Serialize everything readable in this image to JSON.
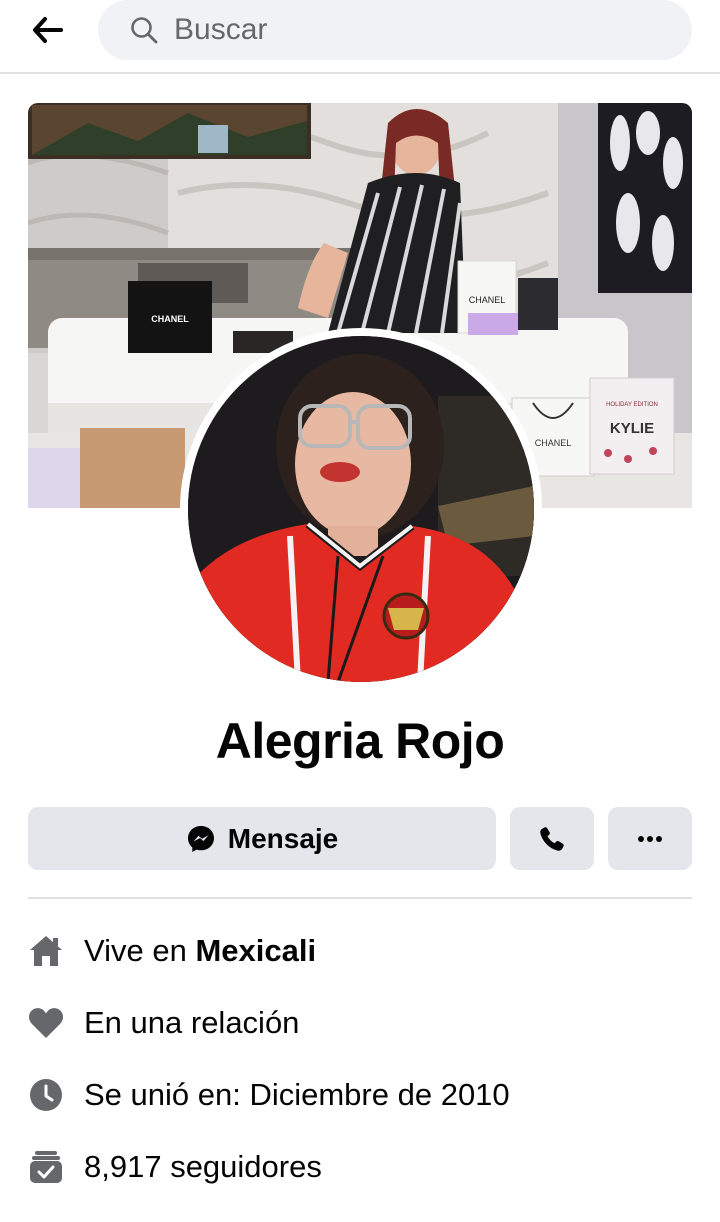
{
  "header": {
    "search_placeholder": "Buscar"
  },
  "cover": {
    "brand_left": "CHANEL",
    "brand_right": "CHANEL",
    "brand_bag": "CHANEL",
    "brand_kylie": "KYLIE",
    "brand_kylie_sub": "HOLIDAY EDITION"
  },
  "profile": {
    "name": "Alegria Rojo"
  },
  "actions": {
    "message_label": "Mensaje"
  },
  "info": {
    "lives_prefix": "Vive en ",
    "lives_city": "Mexicali",
    "relationship": "En una relación",
    "joined": "Se unió en: Diciembre de 2010",
    "followers": "8,917 seguidores"
  },
  "colors": {
    "button_bg": "#e4e6eb",
    "search_bg": "#f0f2f5",
    "icon_gray": "#65676b",
    "text": "#050505"
  }
}
